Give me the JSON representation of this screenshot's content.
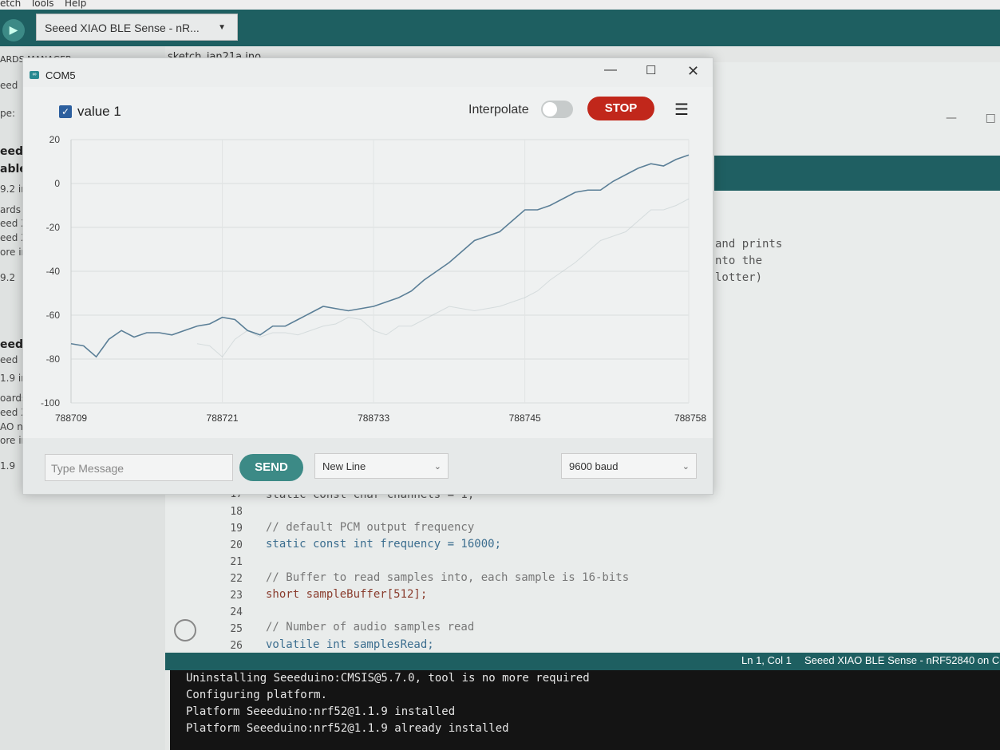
{
  "menu": {
    "items": [
      "etch",
      "Tools",
      "Help"
    ]
  },
  "toolbar": {
    "board": "Seeed XIAO BLE Sense - nR..."
  },
  "sidebar": {
    "header": "ARDS MANAGER",
    "items": [
      {
        "text": "eed"
      },
      {
        "text": "pe:"
      },
      {
        "text": "eed"
      },
      {
        "text": "able"
      },
      {
        "text": "9.2 in"
      },
      {
        "text": "ards"
      },
      {
        "text": "eed X"
      },
      {
        "text": "eed X"
      },
      {
        "text": "ore in"
      },
      {
        "text": "9.2"
      },
      {
        "text": "eed"
      },
      {
        "text": "eed"
      },
      {
        "text": "1.9 in"
      },
      {
        "text": "oards"
      },
      {
        "text": "eed X"
      },
      {
        "text": "AO nR"
      },
      {
        "text": "ore in"
      },
      {
        "text": "1.9"
      }
    ]
  },
  "editor": {
    "tab": "sketch_jan21a.ino",
    "side_comment": [
      "and prints",
      "nto the",
      "lotter)"
    ],
    "lines": [
      {
        "num": "17",
        "code": "static const char channels = 1;"
      },
      {
        "num": "18",
        "code": ""
      },
      {
        "num": "19",
        "code": "// default PCM output frequency"
      },
      {
        "num": "20",
        "code": "static const int frequency = 16000;"
      },
      {
        "num": "21",
        "code": ""
      },
      {
        "num": "22",
        "code": "// Buffer to read samples into, each sample is 16-bits"
      },
      {
        "num": "23",
        "code": "short sampleBuffer[512];"
      },
      {
        "num": "24",
        "code": ""
      },
      {
        "num": "25",
        "code": "// Number of audio samples read"
      },
      {
        "num": "26",
        "code": "volatile int samplesRead;"
      }
    ]
  },
  "statusbar": {
    "position": "Ln 1, Col 1",
    "board": "Seeed XIAO BLE Sense - nRF52840 on CO"
  },
  "console": {
    "lines": [
      "Uninstalling Seeeduino:CMSIS@5.7.0, tool is no more required",
      "Configuring platform.",
      "Platform Seeeduino:nrf52@1.1.9 installed",
      "Platform Seeeduino:nrf52@1.1.9 already installed"
    ]
  },
  "plotter": {
    "title": "COM5",
    "series_label": "value 1",
    "interpolate_label": "Interpolate",
    "interpolate_on": false,
    "stop_label": "STOP",
    "message_placeholder": "Type Message",
    "send_label": "SEND",
    "line_ending": "New Line",
    "baud": "9600 baud",
    "colors": {
      "line": "#5b7f97",
      "ghost": "#a6b4b8",
      "stop": "#c1271b",
      "send": "#3c8a86",
      "header": "#1e5f61"
    }
  },
  "chart_data": {
    "type": "line",
    "title": "",
    "xlabel": "",
    "ylabel": "",
    "ylim": [
      -100,
      20
    ],
    "xlim": [
      788709,
      788758
    ],
    "yticks": [
      20,
      0,
      -20,
      -40,
      -60,
      -80,
      -100
    ],
    "xticks": [
      788709,
      788721,
      788733,
      788745,
      788758
    ],
    "grid": true,
    "series": [
      {
        "name": "value 1",
        "x": [
          788709,
          788710,
          788711,
          788712,
          788713,
          788714,
          788715,
          788716,
          788717,
          788718,
          788719,
          788720,
          788721,
          788722,
          788723,
          788724,
          788725,
          788726,
          788727,
          788728,
          788729,
          788730,
          788731,
          788732,
          788733,
          788734,
          788735,
          788736,
          788737,
          788738,
          788739,
          788740,
          788741,
          788742,
          788743,
          788744,
          788745,
          788746,
          788747,
          788748,
          788749,
          788750,
          788751,
          788752,
          788753,
          788754,
          788755,
          788756,
          788757,
          788758
        ],
        "values": [
          -73,
          -74,
          -79,
          -71,
          -67,
          -70,
          -68,
          -68,
          -69,
          -67,
          -65,
          -64,
          -61,
          -62,
          -67,
          -69,
          -65,
          -65,
          -62,
          -59,
          -56,
          -57,
          -58,
          -57,
          -56,
          -54,
          -52,
          -49,
          -44,
          -40,
          -36,
          -31,
          -26,
          -24,
          -22,
          -17,
          -12,
          -12,
          -10,
          -7,
          -4,
          -3,
          -3,
          1,
          4,
          7,
          9,
          8,
          11,
          13
        ]
      }
    ]
  }
}
